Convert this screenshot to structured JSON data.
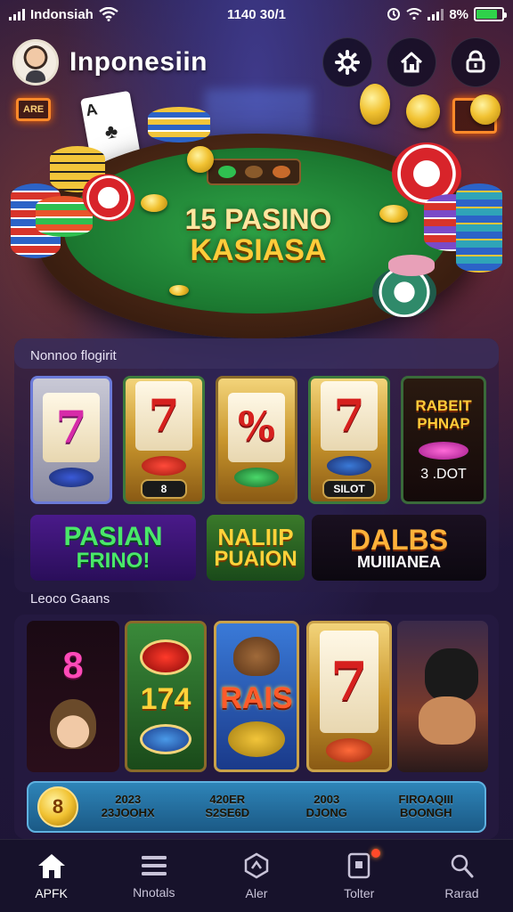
{
  "status_bar": {
    "carrier": "Indonsiah",
    "time": "1140 30/1",
    "battery": "8%"
  },
  "header": {
    "title": "Inponesiin"
  },
  "hero": {
    "title_line1": "15 PASINO",
    "title_line2": "KASIASA",
    "neon_left": "ARE",
    "card_rank": "A"
  },
  "section1": {
    "label": "Nonnoo flogirit",
    "slots": [
      {
        "symbol": "7",
        "plate": ""
      },
      {
        "symbol": "7",
        "plate": "8"
      },
      {
        "symbol": "%",
        "plate": ""
      },
      {
        "symbol": "7",
        "plate": "SILOT"
      },
      {
        "symbol": "RABEIT PHNAP",
        "plate": "3 .DOT"
      }
    ],
    "banners": [
      {
        "line1": "PASIAN",
        "line2": "FRINO!"
      },
      {
        "line1": "NALIIP",
        "line2": "PUAION"
      },
      {
        "line1": "DALBS",
        "line2": "MUIIIANEA"
      }
    ]
  },
  "section2": {
    "label": "Leoco Gaans",
    "tiles": [
      {
        "text": "8"
      },
      {
        "text": "174"
      },
      {
        "text": "RAIS"
      },
      {
        "text": "7"
      },
      {
        "text": ""
      }
    ]
  },
  "stats": {
    "coin": "8",
    "cells": [
      {
        "line1": "2023",
        "line2": "23JOOHX"
      },
      {
        "line1": "420ER",
        "line2": "S2SE6D"
      },
      {
        "line1": "2003",
        "line2": "DJONG"
      },
      {
        "line1": "FIROAQIII",
        "line2": "BOONGH"
      }
    ]
  },
  "nav": [
    {
      "label": "APFK",
      "icon": "home-icon"
    },
    {
      "label": "Nnotals",
      "icon": "menu-icon"
    },
    {
      "label": "Aler",
      "icon": "shield-icon"
    },
    {
      "label": "Tolter",
      "icon": "badge-icon"
    },
    {
      "label": "Rarad",
      "icon": "search-icon"
    }
  ],
  "colors": {
    "accent": "#ffcc3a",
    "felt": "#1c7a31",
    "nav_bg": "#17122b"
  }
}
